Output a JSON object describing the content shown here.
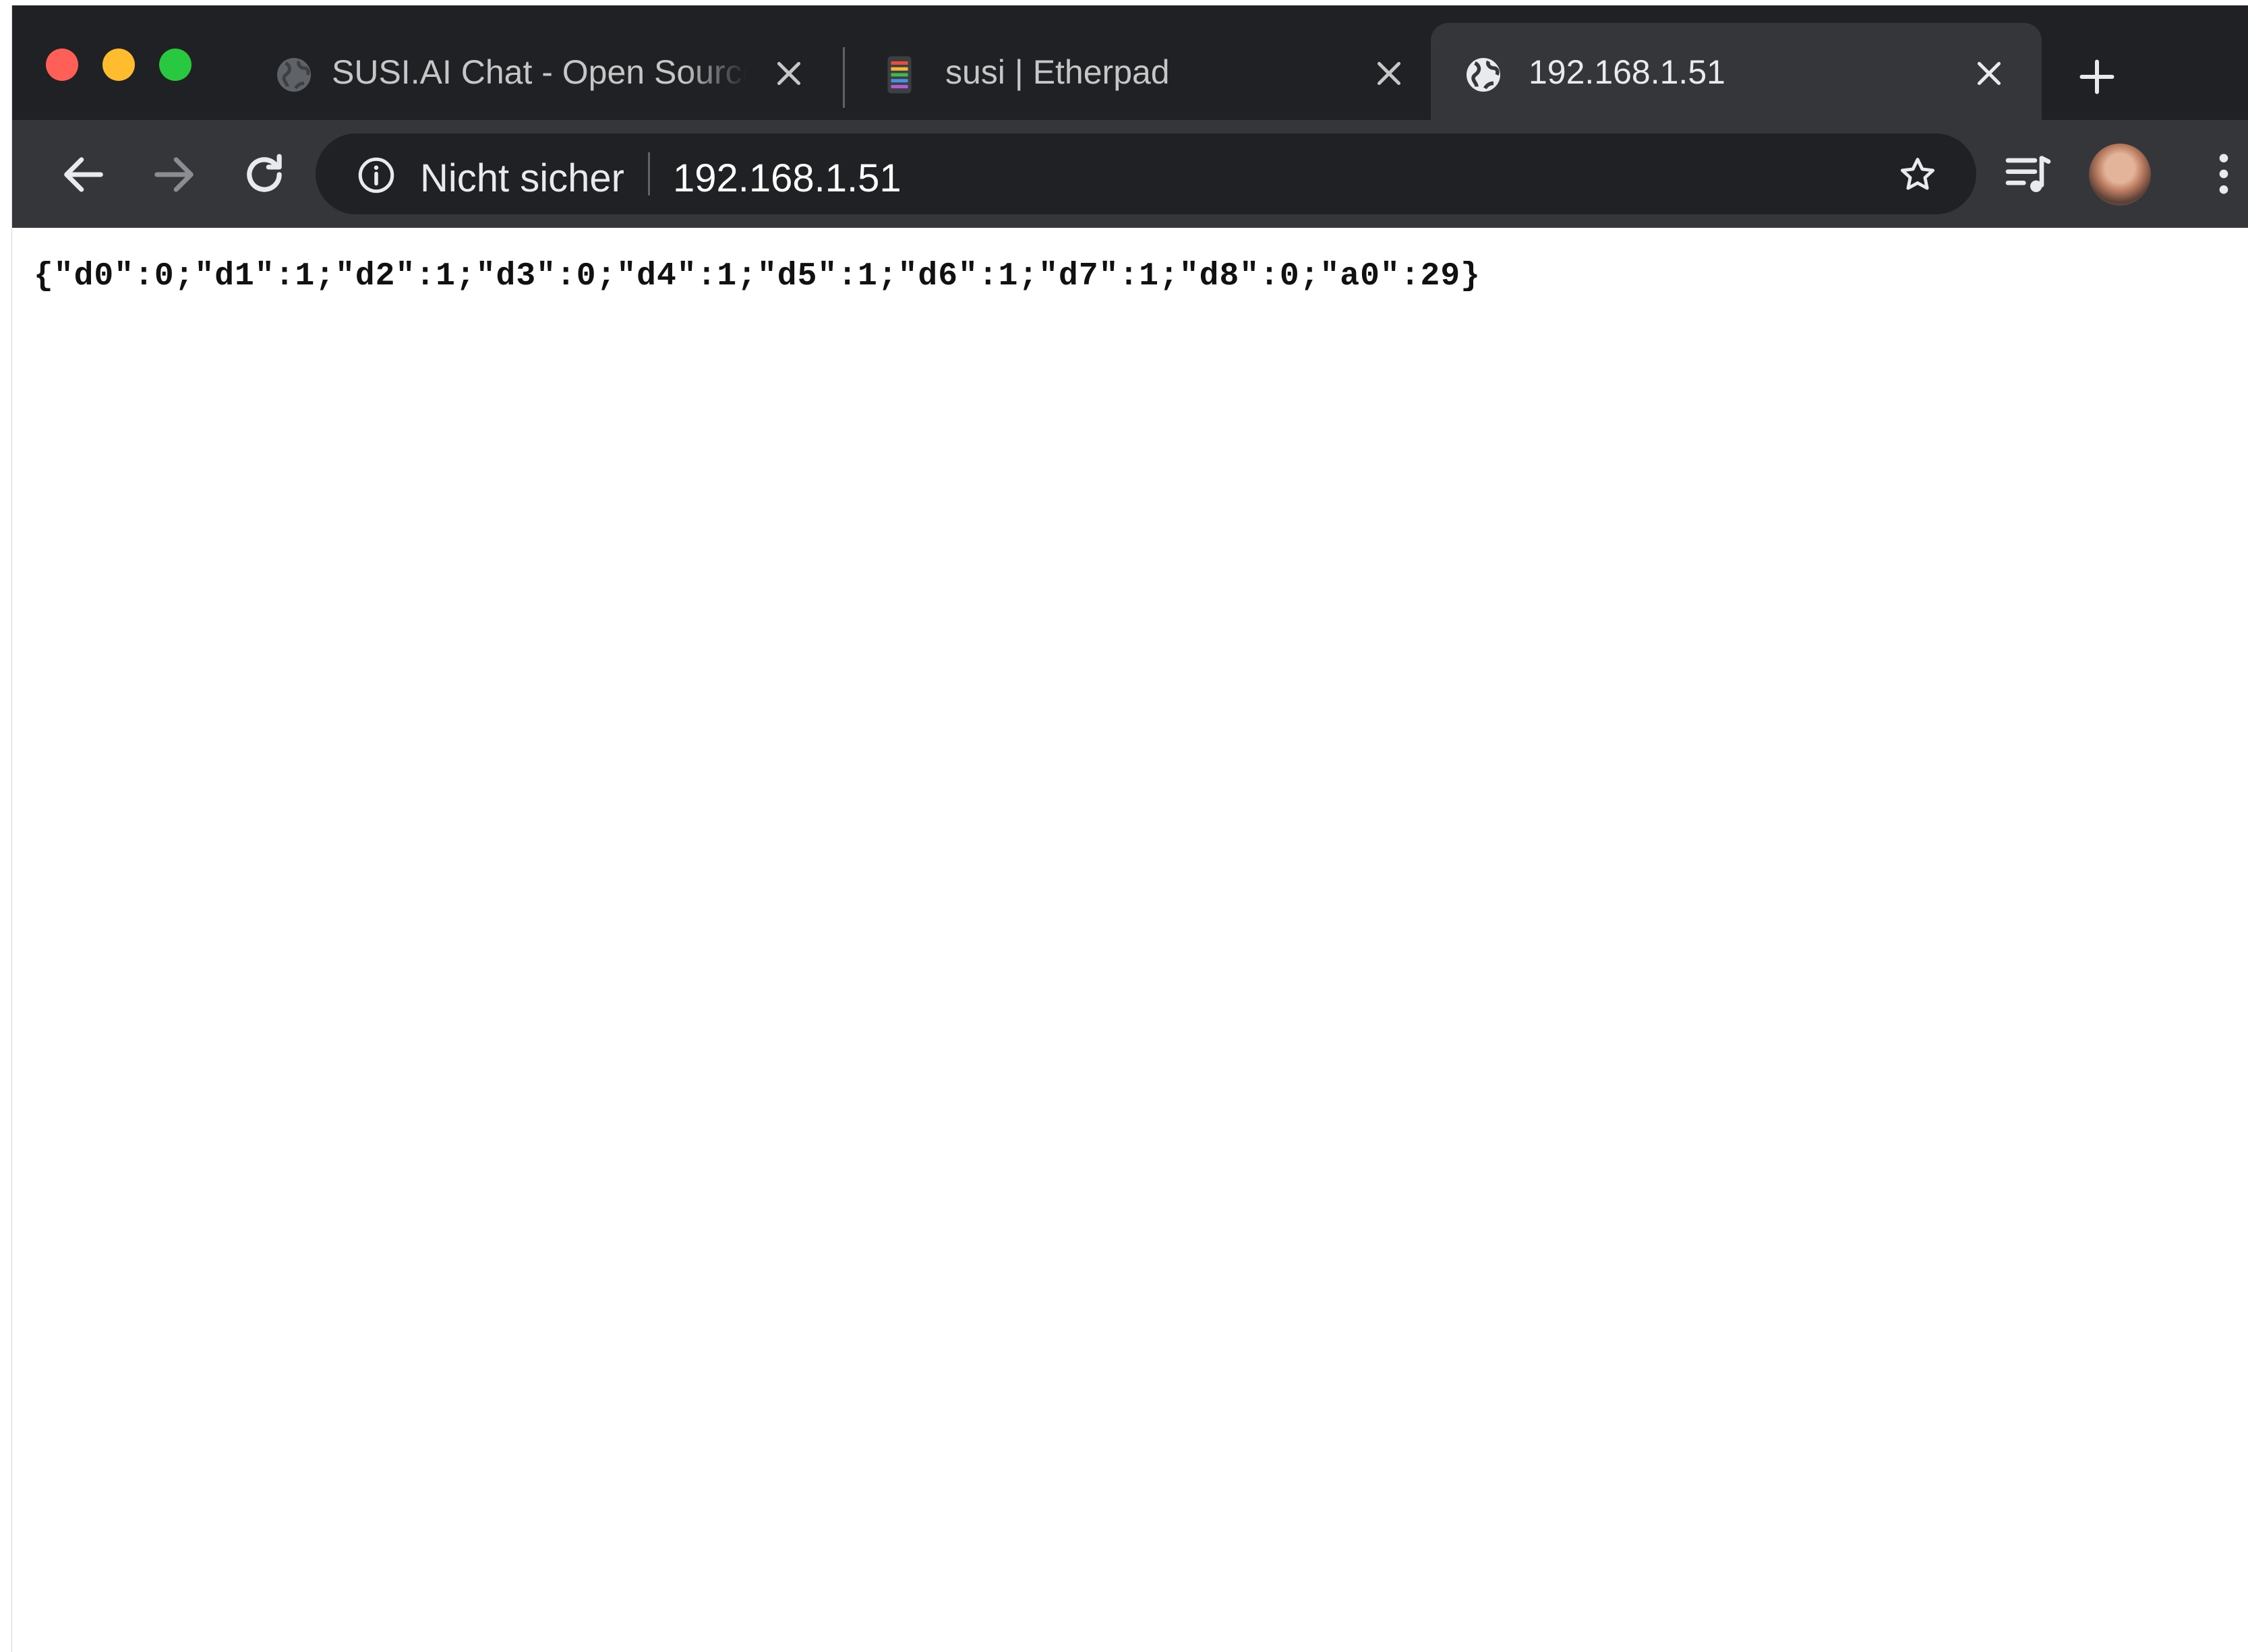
{
  "browser": {
    "tabs": [
      {
        "title": "SUSI.AI Chat - Open Source",
        "favicon": "globe-icon",
        "active": false
      },
      {
        "title": "susi | Etherpad",
        "favicon": "etherpad-icon",
        "active": false
      },
      {
        "title": "192.168.1.51",
        "favicon": "globe-icon",
        "active": true
      }
    ],
    "toolbar": {
      "security_label": "Nicht sicher",
      "url": "192.168.1.51"
    },
    "colors": {
      "frame": "#202124",
      "toolbar": "#35363a",
      "close": "#fe5f57",
      "minimize": "#febc2e",
      "maximize": "#28c840"
    }
  },
  "page": {
    "body_text": "{\"d0\":0;\"d1\":1;\"d2\":1;\"d3\":0;\"d4\":1;\"d5\":1;\"d6\":1;\"d7\":1;\"d8\":0;\"a0\":29}"
  }
}
